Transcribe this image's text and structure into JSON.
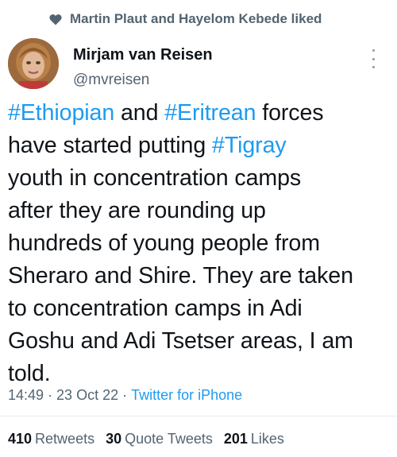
{
  "social_context": {
    "text": "Martin Plaut and Hayelom Kebede liked"
  },
  "author": {
    "name": "Mirjam van Reisen",
    "handle": "@mvreisen"
  },
  "tweet": {
    "lines": [
      [
        {
          "t": "#Ethiopian",
          "tag": true
        },
        {
          "t": " and ",
          "tag": false
        },
        {
          "t": "#Eritrean",
          "tag": true
        },
        {
          "t": " forces",
          "tag": false
        }
      ],
      [
        {
          "t": "have started putting ",
          "tag": false
        },
        {
          "t": "#Tigray",
          "tag": true
        }
      ],
      [
        {
          "t": "youth in concentration camps",
          "tag": false
        }
      ],
      [
        {
          "t": "after they are rounding up",
          "tag": false
        }
      ],
      [
        {
          "t": "hundreds of young people from",
          "tag": false
        }
      ],
      [
        {
          "t": "Sheraro and Shire. They are taken",
          "tag": false
        }
      ],
      [
        {
          "t": "to concentration camps in Adi",
          "tag": false
        }
      ],
      [
        {
          "t": "Goshu and Adi Tsetser areas, I am",
          "tag": false
        }
      ],
      [
        {
          "t": "told.",
          "tag": false
        }
      ]
    ]
  },
  "meta": {
    "time": "14:49",
    "sep1": "·",
    "date": "23 Oct 22",
    "sep2": "·",
    "source": "Twitter for iPhone"
  },
  "stats": {
    "retweets_count": "410",
    "retweets_label": "Retweets",
    "quotes_count": "30",
    "quotes_label": "Quote Tweets",
    "likes_count": "201",
    "likes_label": "Likes"
  },
  "colors": {
    "link": "#1d9bf0",
    "secondary": "#536471",
    "text": "#0f1419"
  },
  "icons": {
    "social": "heart-icon",
    "more": "more-icon"
  }
}
